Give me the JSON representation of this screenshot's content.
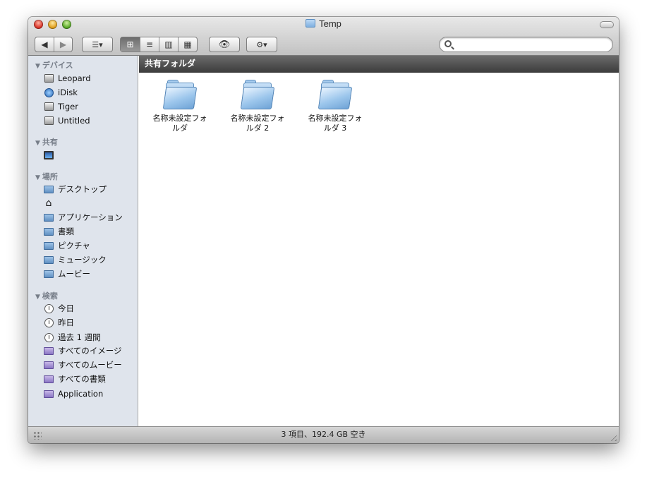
{
  "window": {
    "title": "Temp"
  },
  "toolbar": {
    "back_label": "◀",
    "forward_label": "▶",
    "arrange_label": "☰▾",
    "view_icons_label": "⊞",
    "view_list_label": "≡",
    "view_columns_label": "▥",
    "view_coverflow_label": "▦",
    "quicklook_label": "👁",
    "action_label": "⚙▾",
    "search_value": ""
  },
  "sidebar": {
    "devices": {
      "header": "デバイス",
      "items": [
        {
          "label": "Leopard",
          "icon": "hard-drive-icon"
        },
        {
          "label": "iDisk",
          "icon": "idisk-icon"
        },
        {
          "label": "Tiger",
          "icon": "hard-drive-icon"
        },
        {
          "label": "Untitled",
          "icon": "hard-drive-icon"
        }
      ]
    },
    "shared": {
      "header": "共有",
      "items": [
        {
          "label": "",
          "icon": "monitor-icon"
        }
      ]
    },
    "places": {
      "header": "場所",
      "items": [
        {
          "label": "デスクトップ",
          "icon": "desktop-folder-icon"
        },
        {
          "label": "",
          "icon": "home-icon"
        },
        {
          "label": "アプリケーション",
          "icon": "applications-folder-icon"
        },
        {
          "label": "書類",
          "icon": "documents-folder-icon"
        },
        {
          "label": "ピクチャ",
          "icon": "pictures-folder-icon"
        },
        {
          "label": "ミュージック",
          "icon": "music-folder-icon"
        },
        {
          "label": "ムービー",
          "icon": "movies-folder-icon"
        }
      ]
    },
    "search": {
      "header": "検索",
      "items": [
        {
          "label": "今日",
          "icon": "clock-icon"
        },
        {
          "label": "昨日",
          "icon": "clock-icon"
        },
        {
          "label": "過去 1 週間",
          "icon": "clock-icon"
        },
        {
          "label": "すべてのイメージ",
          "icon": "smart-folder-icon"
        },
        {
          "label": "すべてのムービー",
          "icon": "smart-folder-icon"
        },
        {
          "label": "すべての書類",
          "icon": "smart-folder-icon"
        },
        {
          "label": "Application",
          "icon": "smart-folder-icon"
        }
      ]
    }
  },
  "content": {
    "path_title": "共有フォルダ",
    "files": [
      {
        "line1": "名称未設定フォ",
        "line2": "ルダ"
      },
      {
        "line1": "名称未設定フォ",
        "line2": "ルダ 2"
      },
      {
        "line1": "名称未設定フォ",
        "line2": "ルダ 3"
      }
    ]
  },
  "status": {
    "text": "3 項目、192.4 GB 空き"
  }
}
